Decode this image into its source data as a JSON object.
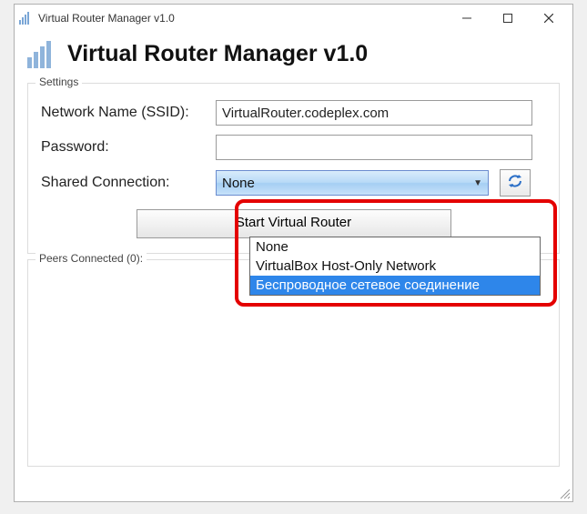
{
  "window": {
    "title": "Virtual Router Manager v1.0"
  },
  "header": {
    "title": "Virtual Router Manager v1.0"
  },
  "settings": {
    "legend": "Settings",
    "ssid_label": "Network Name (SSID):",
    "ssid_value": "VirtualRouter.codeplex.com",
    "password_label": "Password:",
    "password_value": "",
    "shared_label": "Shared Connection:",
    "shared_value": "None",
    "start_button": "Start Virtual Router",
    "options": {
      "0": "None",
      "1": "VirtualBox Host-Only Network",
      "2": "Беспроводное сетевое соединение"
    }
  },
  "peers": {
    "legend": "Peers Connected (0):"
  }
}
